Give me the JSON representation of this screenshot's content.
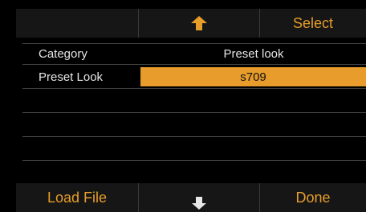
{
  "toolbar": {
    "left_label": "",
    "up_icon": "arrow-up-icon",
    "select_label": "Select"
  },
  "rows": [
    {
      "label": "Category",
      "value": "Preset look",
      "selected": false
    },
    {
      "label": "Preset Look",
      "value": "s709",
      "selected": true
    }
  ],
  "footer": {
    "load_file_label": "Load File",
    "down_icon": "arrow-down-icon",
    "done_label": "Done"
  },
  "colors": {
    "accent": "#e79d2a",
    "selected_bg": "#e89c2b",
    "bar_bg": "#161616",
    "text": "#e6e6e6"
  }
}
